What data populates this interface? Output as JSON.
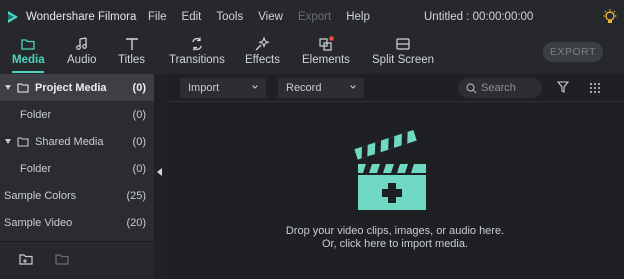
{
  "app": {
    "name": "Wondershare Filmora",
    "project_title": "Untitled : 00:00:00:00",
    "menu": [
      "File",
      "Edit",
      "Tools",
      "View",
      "Export",
      "Help"
    ]
  },
  "toolbar": {
    "tabs": [
      {
        "label": "Media",
        "icon": "folder-icon",
        "active": true
      },
      {
        "label": "Audio",
        "icon": "music-note-icon"
      },
      {
        "label": "Titles",
        "icon": "text-t-icon"
      },
      {
        "label": "Transitions",
        "icon": "transitions-icon"
      },
      {
        "label": "Effects",
        "icon": "sparkle-icon"
      },
      {
        "label": "Elements",
        "icon": "elements-icon",
        "badge": true
      },
      {
        "label": "Split Screen",
        "icon": "split-screen-icon"
      }
    ],
    "export_label": "EXPORT"
  },
  "sidebar": {
    "items": [
      {
        "label": "Project Media",
        "count": "(0)"
      },
      {
        "label": "Folder",
        "count": "(0)"
      },
      {
        "label": "Shared Media",
        "count": "(0)"
      },
      {
        "label": "Folder",
        "count": "(0)"
      },
      {
        "label": "Sample Colors",
        "count": "(25)"
      },
      {
        "label": "Sample Video",
        "count": "(20)"
      }
    ]
  },
  "main": {
    "import_label": "Import",
    "record_label": "Record",
    "search_placeholder": "Search",
    "drop_line1": "Drop your video clips, images, or audio here.",
    "drop_line2": "Or, click here to import media."
  },
  "colors": {
    "accent": "#4bd6c2",
    "badge": "#e8523f",
    "clapper": "#6fd9c3"
  }
}
